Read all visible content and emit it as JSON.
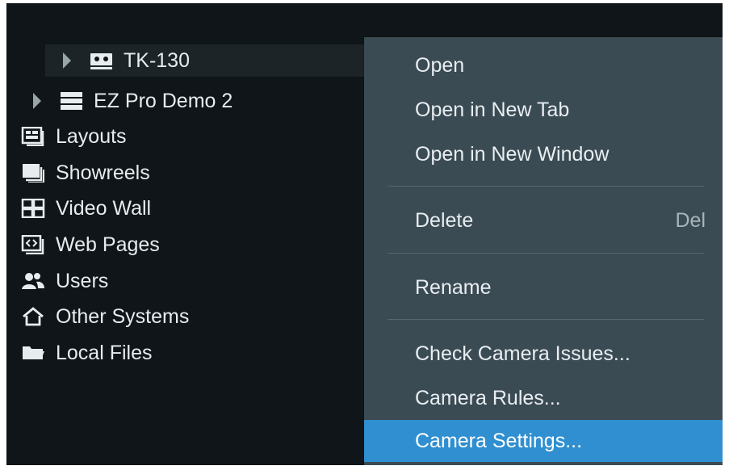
{
  "tree": {
    "items": [
      {
        "label": "TK-130",
        "icon": "camera-icon",
        "expanded": false,
        "selected": true
      },
      {
        "label": "EZ Pro Demo 2",
        "icon": "server-icon",
        "expanded": false,
        "selected": false
      },
      {
        "label": "Layouts",
        "icon": "layouts-icon"
      },
      {
        "label": "Showreels",
        "icon": "showreels-icon"
      },
      {
        "label": "Video Wall",
        "icon": "video-wall-icon"
      },
      {
        "label": "Web Pages",
        "icon": "web-pages-icon"
      },
      {
        "label": "Users",
        "icon": "users-icon"
      },
      {
        "label": "Other Systems",
        "icon": "home-icon"
      },
      {
        "label": "Local Files",
        "icon": "folder-icon"
      }
    ]
  },
  "context_menu": {
    "items": [
      {
        "label": "Open"
      },
      {
        "label": "Open in New Tab"
      },
      {
        "label": "Open in New Window"
      },
      {
        "label": "Delete",
        "shortcut": "Del"
      },
      {
        "label": "Rename"
      },
      {
        "label": "Check Camera Issues..."
      },
      {
        "label": "Camera Rules..."
      },
      {
        "label": "Camera Settings...",
        "highlighted": true
      }
    ]
  },
  "colors": {
    "background": "#0f1518",
    "menu_background": "#3b4b54",
    "highlight": "#2f8fd0",
    "text": "#e7ecee"
  }
}
